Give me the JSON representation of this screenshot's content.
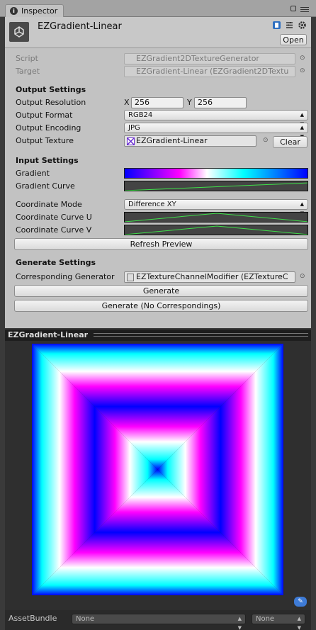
{
  "tab": {
    "label": "Inspector"
  },
  "header": {
    "title": "EZGradient-Linear",
    "open_label": "Open"
  },
  "script": {
    "label": "Script",
    "value": "EZGradient2DTextureGenerator"
  },
  "target": {
    "label": "Target",
    "value": "EZGradient-Linear (EZGradient2DTextu"
  },
  "output": {
    "heading": "Output Settings",
    "resolution_label": "Output Resolution",
    "x_label": "X",
    "x_value": "256",
    "y_label": "Y",
    "y_value": "256",
    "format_label": "Output Format",
    "format_value": "RGB24",
    "encoding_label": "Output Encoding",
    "encoding_value": "JPG",
    "texture_label": "Output Texture",
    "texture_value": "EZGradient-Linear",
    "clear_label": "Clear"
  },
  "input": {
    "heading": "Input Settings",
    "gradient_label": "Gradient",
    "gradient_curve_label": "Gradient Curve",
    "coord_mode_label": "Coordinate Mode",
    "coord_mode_value": "Difference XY",
    "coord_curve_u_label": "Coordinate Curve U",
    "coord_curve_v_label": "Coordinate Curve V",
    "refresh_label": "Refresh Preview"
  },
  "generate": {
    "heading": "Generate Settings",
    "generator_label": "Corresponding Generator",
    "generator_value": "EZTextureChannelModifier (EZTextureC",
    "generate_label": "Generate",
    "generate_no_corr_label": "Generate (No Correspondings)"
  },
  "preview": {
    "title": "EZGradient-Linear"
  },
  "footer": {
    "label": "AssetBundle",
    "bundle_value": "None",
    "variant_value": "None"
  },
  "colors": {
    "curve_line": "#3fe04a",
    "curve_bg": "#444444",
    "accent": "#3e7bd6"
  },
  "icons": [
    "info-icon",
    "lock-icon",
    "menu-icon",
    "unity-logo-icon",
    "book-icon",
    "settings-icon",
    "gear-icon",
    "tag-icon"
  ]
}
